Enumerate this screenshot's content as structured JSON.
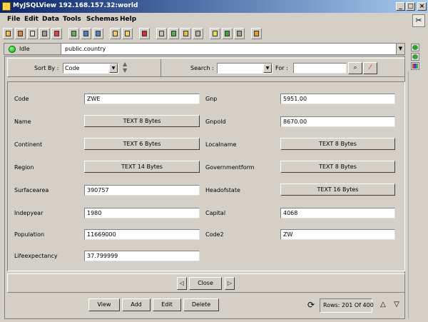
{
  "window": {
    "title": "MyJSQLView   192.168.157.32:world"
  },
  "menu": [
    "File",
    "Edit",
    "Data",
    "Tools",
    "Schemas",
    "Help"
  ],
  "status": {
    "state": "Idle",
    "table": "public.country",
    "state_color": "#22aa22"
  },
  "sortbar": {
    "sort_label": "Sort By :",
    "sort_value": "Code",
    "search_label": "Search :",
    "search_value": "",
    "for_label": "For :",
    "for_value": ""
  },
  "fields": [
    {
      "label": "Code",
      "value": "ZWE",
      "kind": "text"
    },
    {
      "label": "Name",
      "value": "TEXT 8 Bytes",
      "kind": "button"
    },
    {
      "label": "Continent",
      "value": "TEXT 6 Bytes",
      "kind": "button"
    },
    {
      "label": "Region",
      "value": "TEXT 14 Bytes",
      "kind": "button"
    },
    {
      "label": "Surfacearea",
      "value": "390757",
      "kind": "text"
    },
    {
      "label": "Indepyear",
      "value": "1980",
      "kind": "text"
    },
    {
      "label": "Population",
      "value": "11669000",
      "kind": "text"
    },
    {
      "label": "Lifeexpectancy",
      "value": "37.799999",
      "kind": "text"
    },
    {
      "label": "Gnp",
      "value": "5951.00",
      "kind": "text"
    },
    {
      "label": "Gnpold",
      "value": "8670.00",
      "kind": "text"
    },
    {
      "label": "Localname",
      "value": "TEXT 8 Bytes",
      "kind": "button"
    },
    {
      "label": "Governmentform",
      "value": "TEXT 8 Bytes",
      "kind": "button"
    },
    {
      "label": "Headofstate",
      "value": "TEXT 16 Bytes",
      "kind": "button"
    },
    {
      "label": "Capital",
      "value": "4068",
      "kind": "text"
    },
    {
      "label": "Code2",
      "value": "ZW",
      "kind": "text"
    }
  ],
  "nav": {
    "close": "Close"
  },
  "actions": {
    "view": "View",
    "add": "Add",
    "edit": "Edit",
    "delete": "Delete"
  },
  "rows": {
    "text": "Rows: 201 Of 400"
  }
}
